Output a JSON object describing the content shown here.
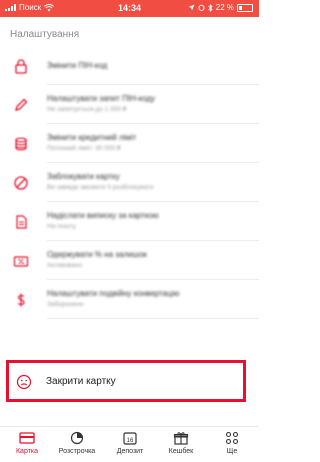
{
  "status_bar": {
    "carrier": "Поиск",
    "time": "14:34",
    "battery": "22 %"
  },
  "settings": {
    "title": "Налаштування",
    "items": [
      {
        "label": "Змінити ПІН-код",
        "sub": "",
        "icon": "lock-icon"
      },
      {
        "label": "Налаштувати запит ПІН-коду",
        "sub": "Не запитується до 1 000 ₴",
        "icon": "pencil-icon"
      },
      {
        "label": "Змінити кредитний ліміт",
        "sub": "Поточний ліміт: 30 000 ₴",
        "icon": "coins-icon"
      },
      {
        "label": "Заблокувати картку",
        "sub": "Ви завжди зможете її розблокувати",
        "icon": "block-icon"
      },
      {
        "label": "Надіслати виписку за карткою",
        "sub": "На пошту",
        "icon": "document-icon"
      },
      {
        "label": "Одержувати % на залишок",
        "sub": "Активовано",
        "icon": "percent-card-icon"
      },
      {
        "label": "Налаштувати подвійну конвертацію",
        "sub": "Заборонено",
        "icon": "dollar-icon"
      }
    ],
    "close_card": {
      "label": "Закрити картку",
      "icon": "sad-face-icon"
    }
  },
  "tab_bar": {
    "tabs": [
      {
        "label": "Картка",
        "icon": "card-icon",
        "active": true
      },
      {
        "label": "Розстрочка",
        "icon": "pie-chart-icon",
        "active": false
      },
      {
        "label": "Депозит",
        "icon": "calendar-icon",
        "active": false
      },
      {
        "label": "Кешбек",
        "icon": "gift-icon",
        "active": false
      },
      {
        "label": "Ще",
        "icon": "more-icon",
        "active": false
      }
    ]
  },
  "colors": {
    "accent": "#e8102c",
    "status_bar": "#f14d43"
  }
}
